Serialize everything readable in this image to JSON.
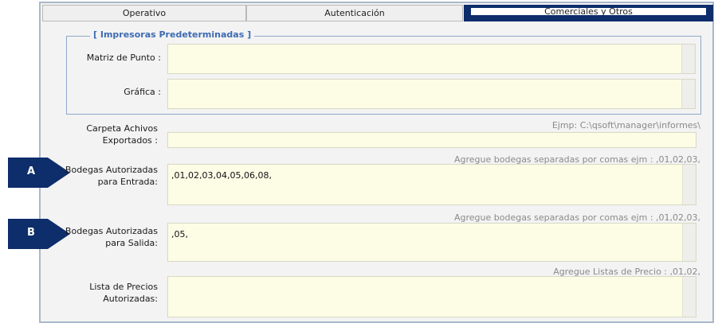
{
  "tabs": [
    {
      "label": "Operativo"
    },
    {
      "label": "Autenticación"
    },
    {
      "label": "Comerciales y Otros"
    }
  ],
  "printers": {
    "title": "[ Impresoras Predeterminadas ]",
    "matrix_label": "Matriz de Punto :",
    "graphic_label": "Gráfica :"
  },
  "export": {
    "label_line1": "Carpeta Achivos",
    "label_line2": "Exportados :",
    "hint": "Ejmp: C:\\qsoft\\manager\\informes\\"
  },
  "in_warehouses": {
    "label_line1": "Bodegas Autorizadas",
    "label_line2": "para Entrada:",
    "hint": "Agregue bodegas separadas por comas ejm : ,01,02,03,",
    "value": ",01,02,03,04,05,06,08,"
  },
  "out_warehouses": {
    "label_line1": "Bodegas Autorizadas",
    "label_line2": "para Salida:",
    "hint": "Agregue bodegas separadas por comas ejm : ,01,02,03,",
    "value": ",05,"
  },
  "price_lists": {
    "label_line1": "Lista de Precios",
    "label_line2": "Autorizadas:",
    "hint": "Agregue Listas de Precio : ,01,02,"
  },
  "markers": {
    "a": "A",
    "b": "B"
  }
}
